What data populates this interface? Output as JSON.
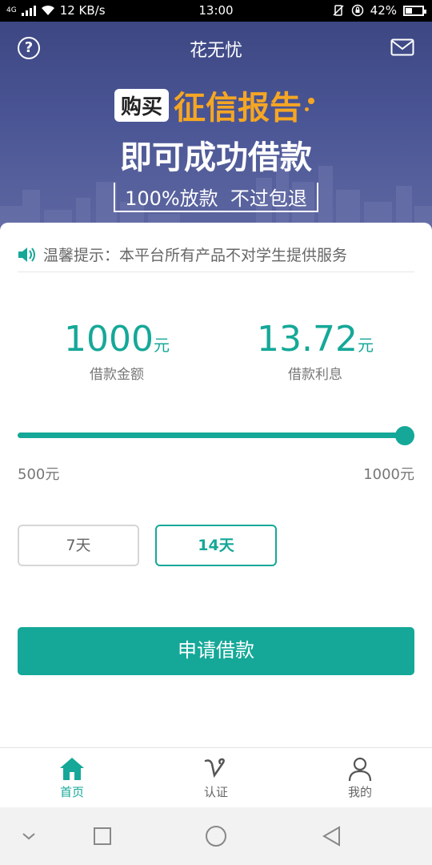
{
  "status_bar": {
    "network": "4G",
    "speed": "12 KB/s",
    "time": "13:00",
    "battery": "42%",
    "battery_level": 0.42
  },
  "header": {
    "title": "花无忧",
    "help_icon": "question-circle-icon",
    "mail_icon": "envelope-icon"
  },
  "banner": {
    "buy_tag": "购买",
    "highlight": "征信报告",
    "headline": "即可成功借款",
    "subline": "100%放款  不过包退"
  },
  "notice": {
    "icon": "speaker-icon",
    "text": "温馨提示：本平台所有产品不对学生提供服务"
  },
  "loan": {
    "amount_value": "1000",
    "amount_unit": "元",
    "amount_label": "借款金额",
    "interest_value": "13.72",
    "interest_unit": "元",
    "interest_label": "借款利息"
  },
  "slider": {
    "min_label": "500元",
    "max_label": "1000元",
    "min": 500,
    "max": 1000,
    "value": 1000
  },
  "terms": [
    {
      "label": "7天",
      "selected": false
    },
    {
      "label": "14天",
      "selected": true
    }
  ],
  "apply_button": "申请借款",
  "tabs": [
    {
      "label": "首页",
      "icon": "home-icon",
      "active": true
    },
    {
      "label": "认证",
      "icon": "verify-v-icon",
      "active": false
    },
    {
      "label": "我的",
      "icon": "user-icon",
      "active": false
    }
  ],
  "colors": {
    "accent": "#15a898",
    "banner": "#4a5595",
    "highlight": "#f5a623"
  }
}
